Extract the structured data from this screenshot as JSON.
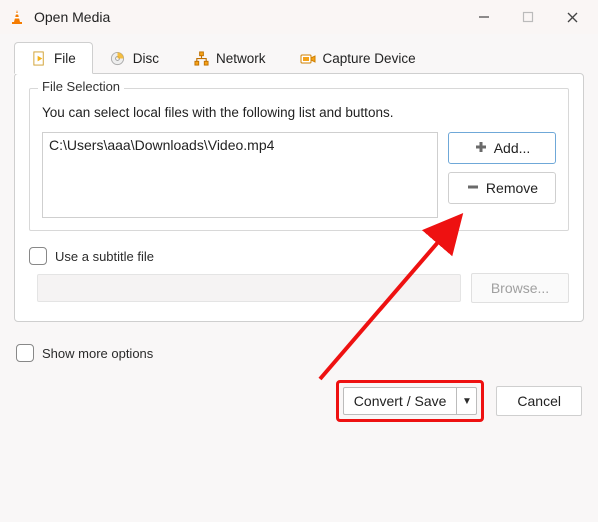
{
  "window": {
    "title": "Open Media"
  },
  "tabs": {
    "file": "File",
    "disc": "Disc",
    "network": "Network",
    "capture": "Capture Device"
  },
  "file_selection": {
    "legend": "File Selection",
    "description": "You can select local files with the following list and buttons.",
    "files": [
      "C:\\Users\\aaa\\Downloads\\Video.mp4"
    ],
    "add_button": "Add...",
    "remove_button": "Remove"
  },
  "subtitle": {
    "label": "Use a subtitle file",
    "browse_button": "Browse..."
  },
  "options": {
    "show_more": "Show more options"
  },
  "footer": {
    "convert_save": "Convert / Save",
    "cancel": "Cancel"
  }
}
